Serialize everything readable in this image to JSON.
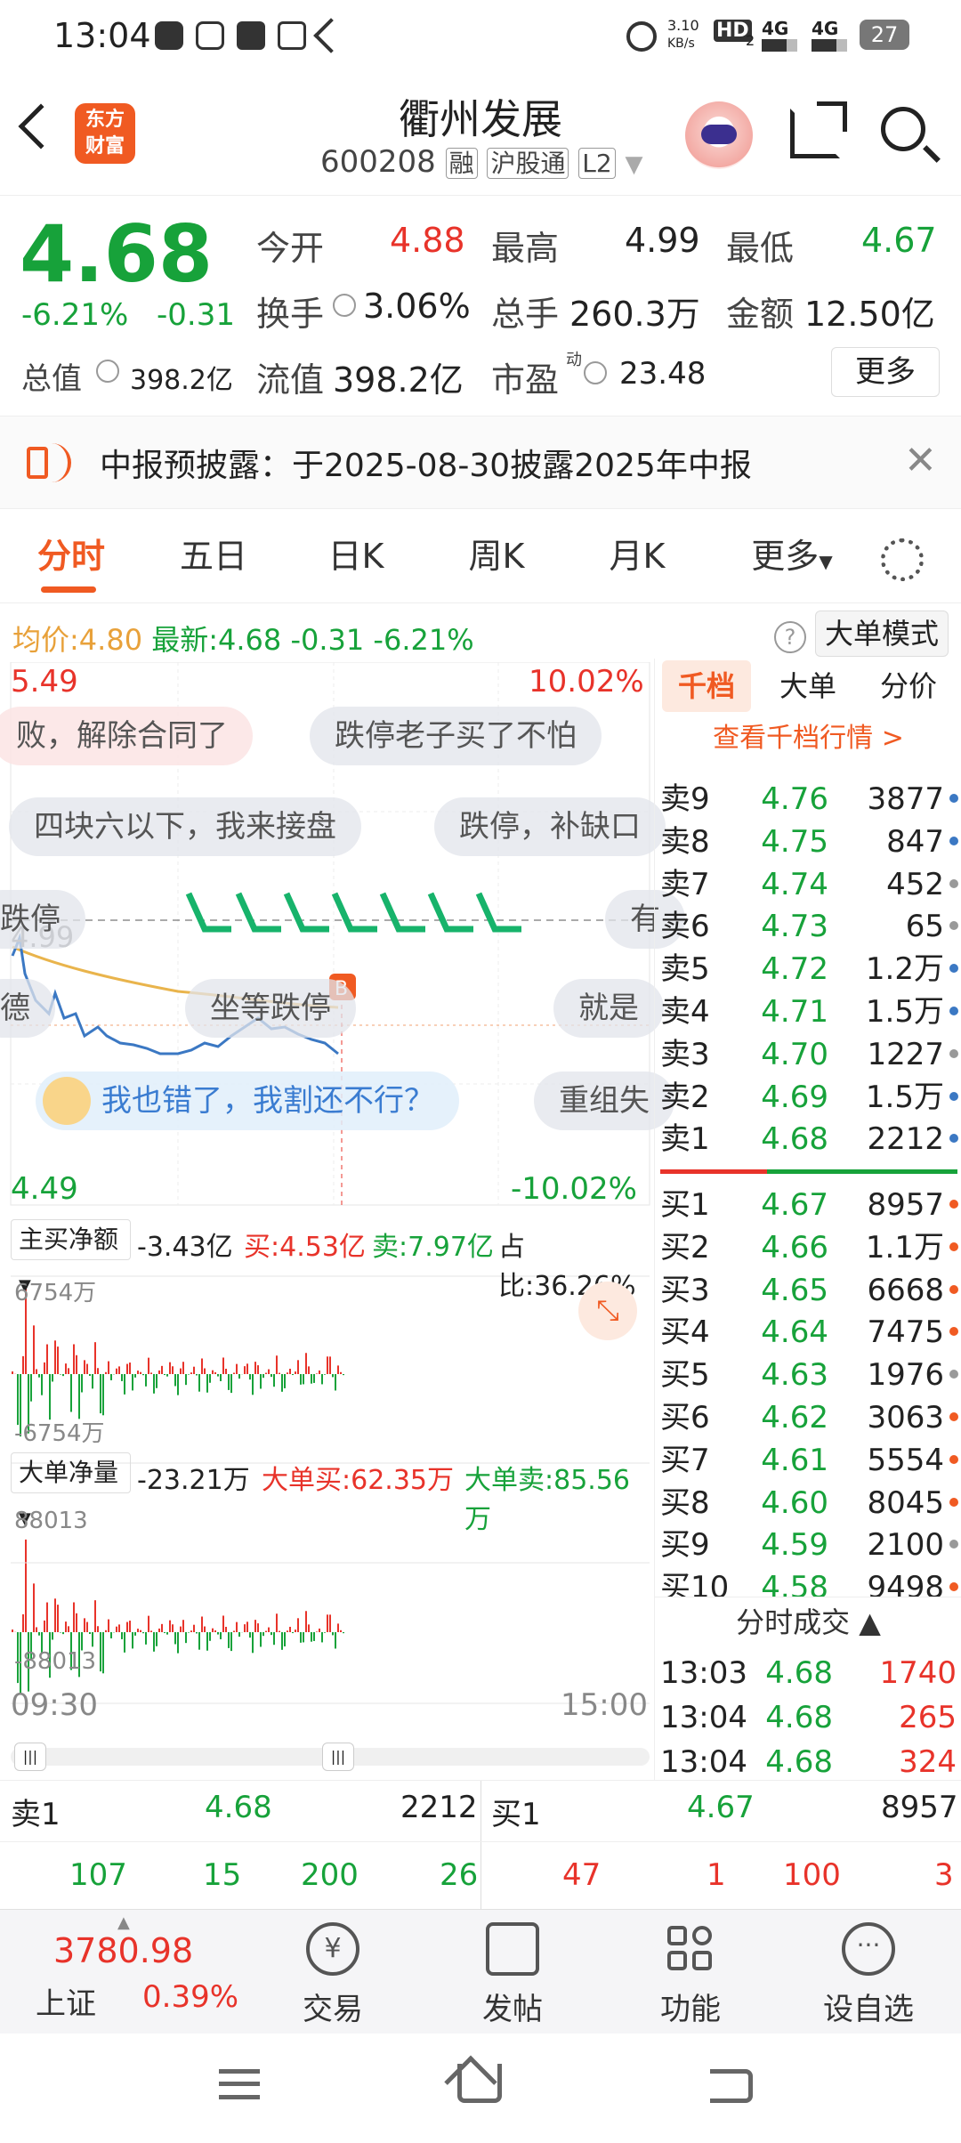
{
  "status_bar": {
    "time": "13:04",
    "net_speed_top": "3.10",
    "net_speed_bottom": "KB/s",
    "hd": "HD",
    "hd_sub": "2",
    "sig1": "4G",
    "sig2": "4G",
    "battery": "27"
  },
  "header": {
    "back": "<",
    "brand_line1": "东方",
    "brand_line2": "财富",
    "stock_name": "衢州发展",
    "stock_code": "600208",
    "tag_margin": "融",
    "tag_connect": "沪股通",
    "tag_level": "L2"
  },
  "quote": {
    "price": "4.68",
    "change_pct": "-6.21%",
    "change": "-0.31",
    "open_label": "今开",
    "open": "4.88",
    "high_label": "最高",
    "high": "4.99",
    "low_label": "最低",
    "low": "4.67",
    "turnover_label": "换手",
    "turnover": "3.06%",
    "volume_label": "总手",
    "volume": "260.3万",
    "amount_label": "金额",
    "amount": "12.50亿",
    "mktcap_label": "总值",
    "mktcap": "398.2亿",
    "float_label": "流值",
    "float_cap": "398.2亿",
    "pe_label": "市盈",
    "pe_sup": "动",
    "pe": "23.48",
    "more_button": "更多"
  },
  "notice": {
    "text": "中报预披露：于2025-08-30披露2025年中报"
  },
  "tabs": [
    {
      "label": "分时"
    },
    {
      "label": "五日"
    },
    {
      "label": "日K"
    },
    {
      "label": "周K"
    },
    {
      "label": "月K"
    },
    {
      "label": "更多"
    }
  ],
  "chart_info": {
    "avg_label": "均价:",
    "avg": "4.80",
    "latest_label": "最新:",
    "latest": "4.68",
    "chg": "-0.31",
    "pct": "-6.21%",
    "mode_button": "大单模式"
  },
  "chart_axis": {
    "top_price": "5.49",
    "top_pct": "10.02%",
    "bottom_price": "4.49",
    "bottom_pct": "-10.02%",
    "open_price": "4.99",
    "time_start": "09:30",
    "time_end": "15:00"
  },
  "bubbles": [
    "败，解除合同了",
    "跌停老子买了不怕",
    "四块六以下，我来接盘",
    "跌停，补缺口",
    "跌停",
    "有",
    "德",
    "坐等跌停",
    "就是",
    "我也错了，我割还不行？",
    "重组失"
  ],
  "panel1": {
    "label": "主买净额",
    "value": "-3.43亿",
    "buy": "买:4.53亿",
    "sell": "卖:7.97亿",
    "ratio": "占比:36.26%",
    "ymax": "6754万",
    "ymin": "-6754万"
  },
  "panel2": {
    "label": "大单净量",
    "value": "-23.21万",
    "buy": "大单买:62.35万",
    "sell": "大单卖:85.56万",
    "ymax": "88013",
    "ymin": "-88013"
  },
  "orderbook": {
    "tabs": [
      {
        "label": "千档"
      },
      {
        "label": "大单"
      },
      {
        "label": "分价"
      }
    ],
    "view_link": "查看千档行情 >",
    "asks": [
      {
        "label": "卖9",
        "price": "4.76",
        "vol": "3877"
      },
      {
        "label": "卖8",
        "price": "4.75",
        "vol": "847"
      },
      {
        "label": "卖7",
        "price": "4.74",
        "vol": "452"
      },
      {
        "label": "卖6",
        "price": "4.73",
        "vol": "65"
      },
      {
        "label": "卖5",
        "price": "4.72",
        "vol": "1.2万"
      },
      {
        "label": "卖4",
        "price": "4.71",
        "vol": "1.5万"
      },
      {
        "label": "卖3",
        "price": "4.70",
        "vol": "1227"
      },
      {
        "label": "卖2",
        "price": "4.69",
        "vol": "1.5万"
      },
      {
        "label": "卖1",
        "price": "4.68",
        "vol": "2212"
      }
    ],
    "bids": [
      {
        "label": "买1",
        "price": "4.67",
        "vol": "8957"
      },
      {
        "label": "买2",
        "price": "4.66",
        "vol": "1.1万"
      },
      {
        "label": "买3",
        "price": "4.65",
        "vol": "6668"
      },
      {
        "label": "买4",
        "price": "4.64",
        "vol": "7475"
      },
      {
        "label": "买5",
        "price": "4.63",
        "vol": "1976"
      },
      {
        "label": "买6",
        "price": "4.62",
        "vol": "3063"
      },
      {
        "label": "买7",
        "price": "4.61",
        "vol": "5554"
      },
      {
        "label": "买8",
        "price": "4.60",
        "vol": "8045"
      },
      {
        "label": "买9",
        "price": "4.59",
        "vol": "2100"
      },
      {
        "label": "买10",
        "price": "4.58",
        "vol": "9498"
      }
    ],
    "trades_title": "分时成交",
    "trades": [
      {
        "time": "13:03",
        "price": "4.68",
        "vol": "1740"
      },
      {
        "time": "13:04",
        "price": "4.68",
        "vol": "265"
      },
      {
        "time": "13:04",
        "price": "4.68",
        "vol": "324"
      }
    ]
  },
  "bottom_ticks": {
    "sell_label": "卖1",
    "sell_price": "4.68",
    "sell_vol": "2212",
    "buy_label": "买1",
    "buy_price": "4.67",
    "buy_vol": "8957",
    "sell_row": [
      "107",
      "15",
      "200",
      "26"
    ],
    "buy_row": [
      "47",
      "1",
      "100",
      "3"
    ]
  },
  "bottom_nav": {
    "index_value": "3780.98",
    "index_name": "上证",
    "index_pct": "0.39%",
    "trade": "交易",
    "post": "发帖",
    "func": "功能",
    "watch": "设自选"
  }
}
